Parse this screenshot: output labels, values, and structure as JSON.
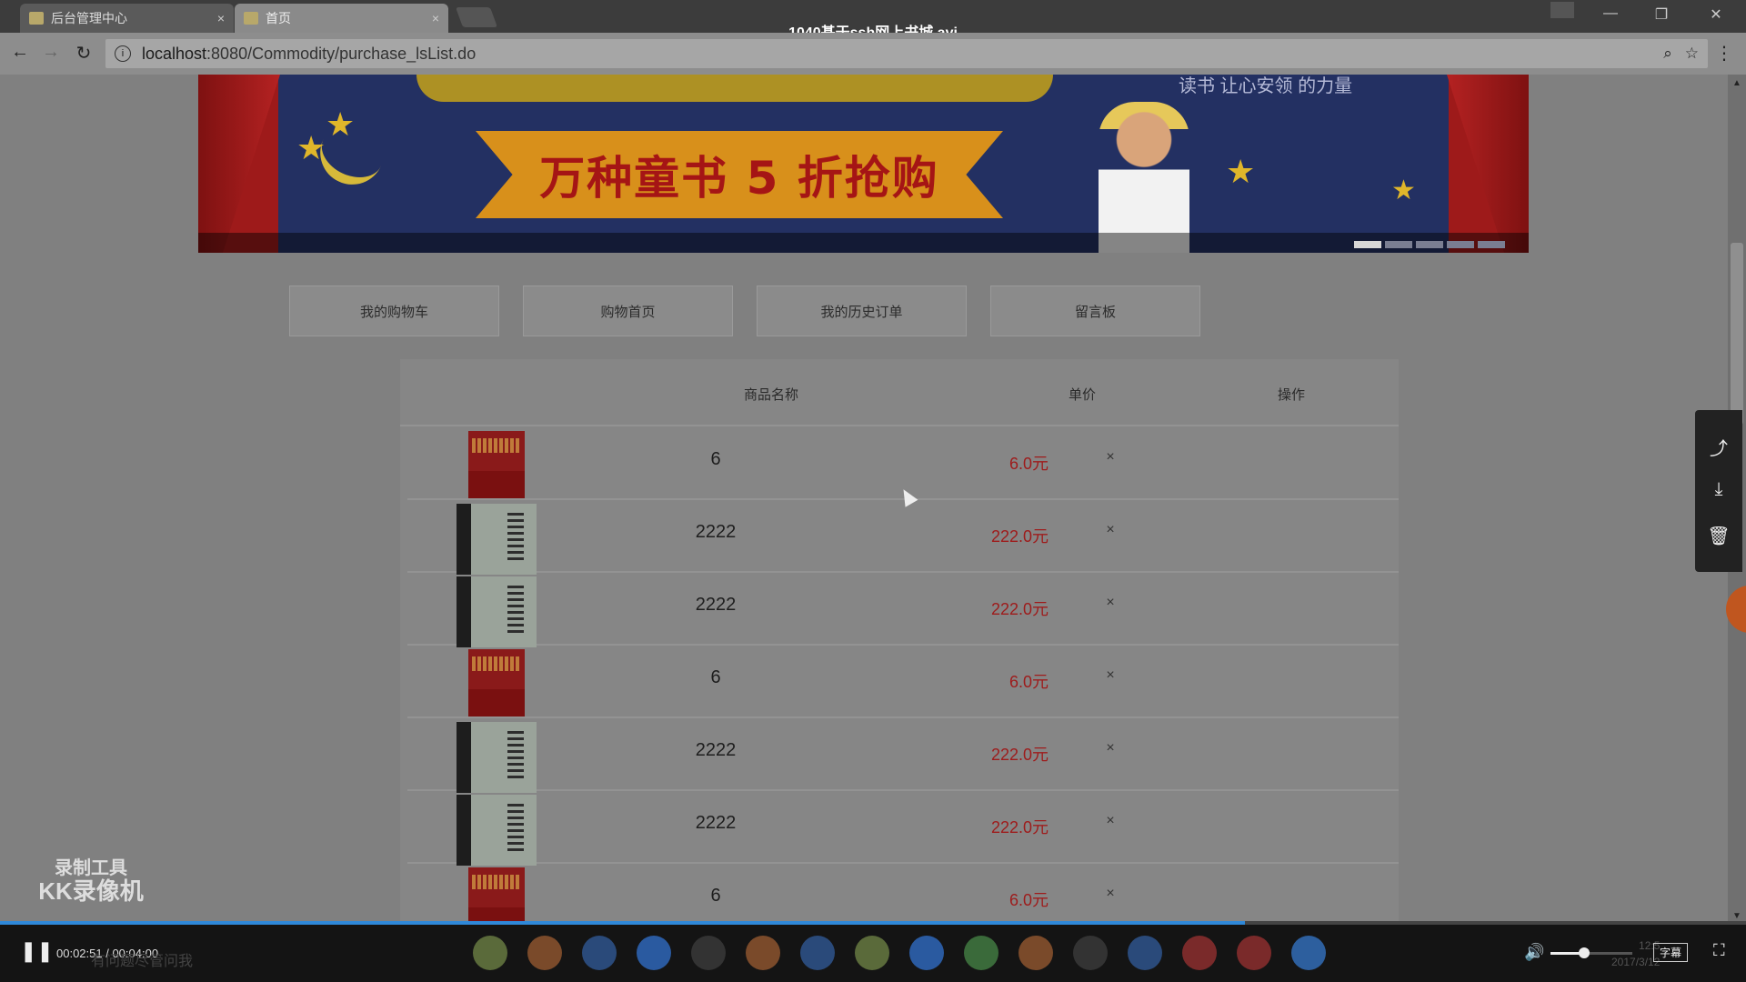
{
  "video": {
    "title": "1040基于ssh网上书城.avi"
  },
  "browser": {
    "tabs": [
      {
        "label": "后台管理中心",
        "close": "×"
      },
      {
        "label": "首页",
        "close": "×"
      }
    ],
    "url_host": "localhost",
    "url_path": ":8080/Commodity/purchase_lsList.do",
    "window_controls": {
      "minimize": "—",
      "restore": "❐",
      "close": "✕"
    }
  },
  "banner": {
    "headline": "万种童书 5 折抢购",
    "tagline": "读书 让心安领 的力量",
    "slides": 5,
    "active_slide": 1
  },
  "nav": {
    "items": [
      "我的购物车",
      "购物首页",
      "我的历史订单",
      "留言板"
    ]
  },
  "cart": {
    "columns": {
      "name": "商品名称",
      "price": "单价",
      "action": "操作"
    },
    "rows": [
      {
        "cover": "red",
        "name": "6",
        "price": "6.0元",
        "action": "×"
      },
      {
        "cover": "bw",
        "name": "2222",
        "price": "222.0元",
        "action": "×"
      },
      {
        "cover": "bw",
        "name": "2222",
        "price": "222.0元",
        "action": "×"
      },
      {
        "cover": "red",
        "name": "6",
        "price": "6.0元",
        "action": "×"
      },
      {
        "cover": "bw",
        "name": "2222",
        "price": "222.0元",
        "action": "×"
      },
      {
        "cover": "bw",
        "name": "2222",
        "price": "222.0元",
        "action": "×"
      },
      {
        "cover": "red",
        "name": "6",
        "price": "6.0元",
        "action": "×"
      }
    ]
  },
  "watermark": {
    "line1": "录制工具",
    "line2": "KK录像机"
  },
  "player": {
    "time": "00:02:51 / 00:04:00",
    "progress": 0.713,
    "subtitle_label": "字幕",
    "clock_time": "12:5",
    "clock_date": "2017/3/12",
    "ghost_text": "有问题尽管问我"
  },
  "colors": {
    "price": "#9e1b1b",
    "progress": "#2f88d8",
    "banner_bg": "#233062"
  }
}
